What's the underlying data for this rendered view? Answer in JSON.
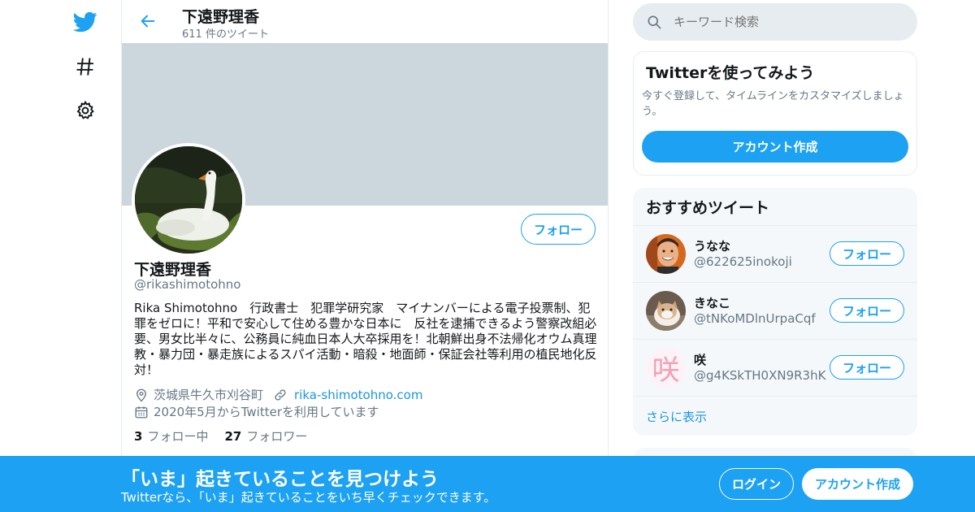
{
  "colors": {
    "brand": "#1da1f2",
    "link": "#1b95e0",
    "muted": "#657786",
    "banner": "#ccd6dd"
  },
  "nav": {
    "icons": [
      "twitter-logo-icon",
      "hashtag-icon",
      "gear-icon"
    ]
  },
  "header": {
    "name": "下遠野理香",
    "tweet_count": "611 件のツイート"
  },
  "profile": {
    "name": "下遠野理香",
    "handle": "@rikashimotohno",
    "follow_label": "フォロー",
    "bio": "Rika Shimotohno　行政書士　犯罪学研究家　マイナンバーによる電子投票制、犯罪をゼロに！平和で安心して住める豊かな日本に　反社を逮捕できるよう警察改組必要、男女比半々に、公務員に純血日本人大卒採用を！北朝鮮出身不法帰化オウム真理教・暴力団・暴走族によるスパイ活動・暗殺・地面師・保証会社等利用の植民地化反対！",
    "location": "茨城県牛久市刈谷町",
    "website": "rika-shimotohno.com",
    "joined": "2020年5月からTwitterを利用しています",
    "following_count": "3",
    "following_label": "フォロー中",
    "followers_count": "27",
    "followers_label": "フォロワー"
  },
  "search": {
    "placeholder": "キーワード検索"
  },
  "signup_card": {
    "title": "Twitterを使ってみよう",
    "description": "今すぐ登録して、タイムラインをカスタマイズしましょう。",
    "button": "アカウント作成"
  },
  "recommendations": {
    "title": "おすすめツイート",
    "items": [
      {
        "name": "うなな",
        "handle": "@622625inokoji",
        "follow": "フォロー"
      },
      {
        "name": "きなこ",
        "handle": "@tNKoMDlnUrpaCqf",
        "follow": "フォロー"
      },
      {
        "name": "咲",
        "handle": "@g4KSkTH0XN9R3hK",
        "follow": "フォロー",
        "avatar_text": "咲"
      }
    ],
    "show_more": "さらに表示"
  },
  "bottom_bar": {
    "title": "「いま」起きていることを見つけよう",
    "subtitle": "Twitterなら、「いま」起きていることをいち早くチェックできます。",
    "login": "ログイン",
    "signup": "アカウント作成"
  }
}
